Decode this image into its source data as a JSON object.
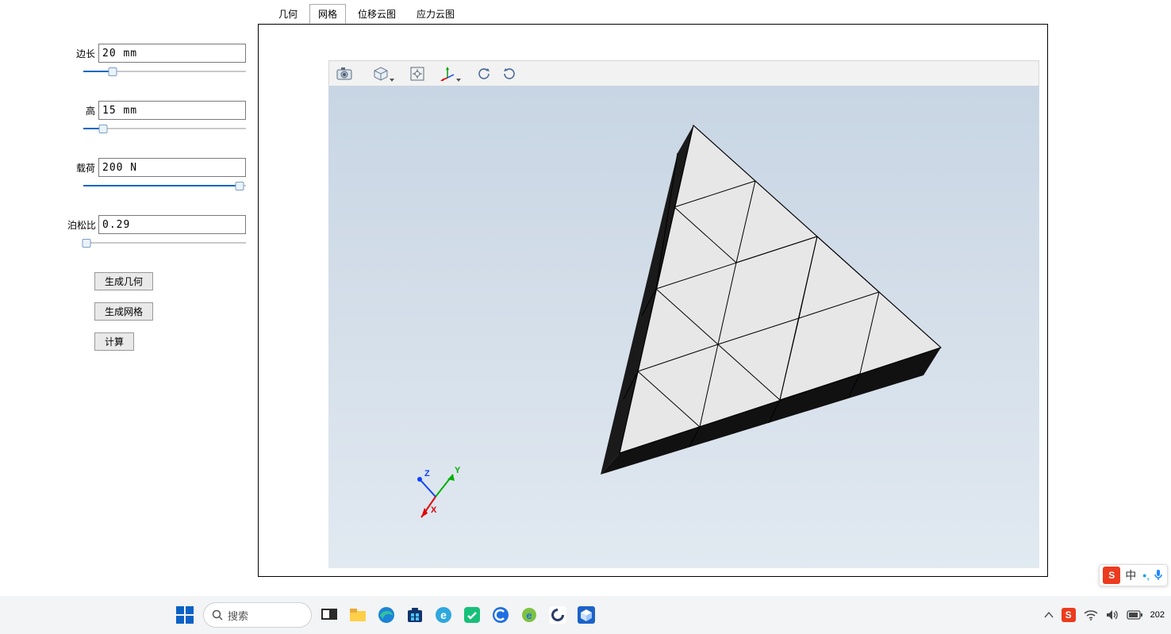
{
  "sidebar": {
    "fields": [
      {
        "label": "边长",
        "value": "20 mm",
        "slider_pct": 18
      },
      {
        "label": "高",
        "value": "15 mm",
        "slider_pct": 12
      },
      {
        "label": "载荷",
        "value": "200 N",
        "slider_pct": 96
      },
      {
        "label": "泊松比",
        "value": "0.29",
        "slider_pct": 2
      }
    ],
    "buttons": {
      "gen_geom": "生成几何",
      "gen_mesh": "生成网格",
      "calc": "计算"
    }
  },
  "tabs": {
    "items": [
      "几何",
      "网格",
      "位移云图",
      "应力云图"
    ],
    "active_index": 1
  },
  "viewer": {
    "toolbar_icons": [
      "camera",
      "cube",
      "fit",
      "axis",
      "rotate-ccw",
      "rotate-cw"
    ],
    "triad": {
      "x": "X",
      "y": "Y",
      "z": "Z"
    }
  },
  "taskbar": {
    "search_placeholder": "搜索",
    "tray_year": "202"
  },
  "ime": {
    "brand": "S",
    "lang": "中",
    "dots": "•,"
  }
}
